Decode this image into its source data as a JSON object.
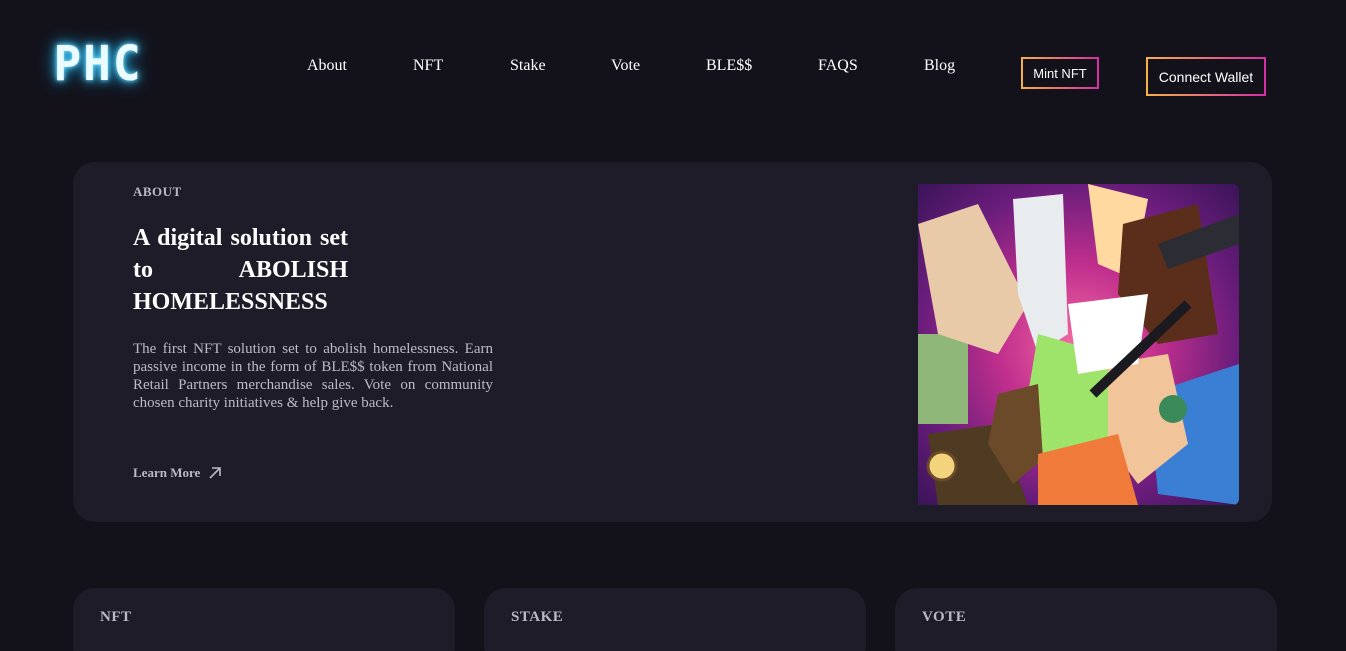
{
  "header": {
    "logo_text": "PHC",
    "nav": [
      "About",
      "NFT",
      "Stake",
      "Vote",
      "BLE$$",
      "FAQS",
      "Blog"
    ],
    "mint_label": "Mint NFT",
    "wallet_label": "Connect Wallet"
  },
  "about": {
    "label": "ABOUT",
    "heading": "A digital solution set to ABOLISH HOMELESSNESS",
    "description": "The first NFT solution set to abolish homelessness. Earn passive income in the form of BLE$$ token from National Retail Partners merchandise sales. Vote on community chosen charity initiatives & help give back.",
    "learn_more": "Learn More"
  },
  "cards": [
    "NFT",
    "STAKE",
    "VOTE"
  ],
  "colors": {
    "background": "#13121b",
    "card": "#1d1c28",
    "gradient_start": "#f5b14a",
    "gradient_end": "#d42fa4",
    "muted_text": "#bcb8c9"
  }
}
